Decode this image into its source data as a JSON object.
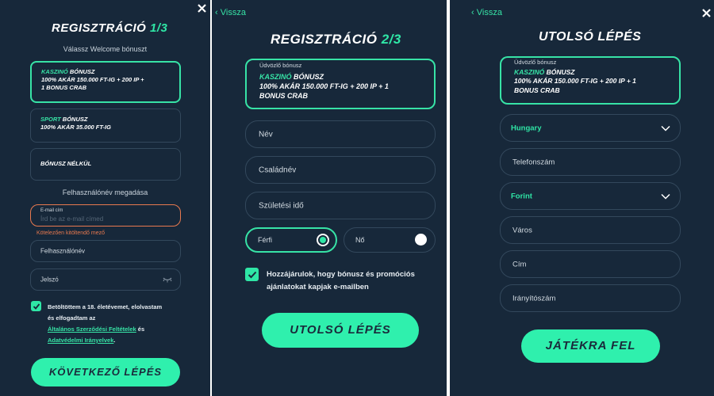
{
  "panel1": {
    "title_main": "REGISZTRÁCIÓ",
    "title_step": "1/3",
    "subtitle": "Válassz Welcome bónuszt",
    "bonus_options": [
      {
        "accent": "KASZINÓ",
        "rest": " BÓNUSZ",
        "line2": "100% AKÁR 150.000 FT-IG + 200 IP +",
        "line3": "1 BONUS CRAB",
        "selected": true
      },
      {
        "accent": "SPORT",
        "rest": " BÓNUSZ",
        "line2": "100% AKÁR 35.000 FT-IG",
        "line3": "",
        "selected": false
      },
      {
        "accent": "",
        "rest": "BÓNUSZ NÉLKÜL",
        "line2": "",
        "line3": "",
        "selected": false
      }
    ],
    "username_section": "Felhasználónév megadása",
    "email_label": "E-mail cím",
    "email_placeholder": "Írd be az e-mail címed",
    "email_error": "Kötelezően kitöltendő mező",
    "username_placeholder": "Felhasználónév",
    "password_placeholder": "Jelszó",
    "terms_line1": "Betöltöttem a 18. életévemet, elolvastam",
    "terms_line2": "és elfogadtam az",
    "terms_link1": "Általános Szerződési Feltételek",
    "terms_and": " és",
    "terms_link2": "Adatvédelmi Irányelvek",
    "terms_end": ".",
    "next_button": "KÖVETKEZŐ LÉPÉS"
  },
  "panel2": {
    "back_label": "Vissza",
    "title_main": "REGISZTRÁCIÓ",
    "title_step": "2/3",
    "bonus_caption": "Üdvözlő bónusz",
    "bonus_accent": "KASZINÓ",
    "bonus_rest": " BÓNUSZ",
    "bonus_line2": "100% AKÁR 150.000 FT-IG + 200 IP + 1",
    "bonus_line3": "BONUS CRAB",
    "first_name_placeholder": "Név",
    "last_name_placeholder": "Családnév",
    "birth_placeholder": "Születési idő",
    "gender_male": "Férfi",
    "gender_female": "Nő",
    "gender_selected": "Férfi",
    "consent_line1": "Hozzájárulok, hogy bónusz és promóciós",
    "consent_line2": "ajánlatokat kapjak e-mailben",
    "last_step_button": "UTOLSÓ LÉPÉS"
  },
  "panel3": {
    "back_label": "Vissza",
    "title": "UTOLSÓ LÉPÉS",
    "bonus_caption": "Üdvözlő bónusz",
    "bonus_accent": "KASZINÓ",
    "bonus_rest": " BÓNUSZ",
    "bonus_line2": "100% AKÁR 150.000 FT-IG + 200 IP + 1",
    "bonus_line3": "BONUS CRAB",
    "country_value": "Hungary",
    "phone_placeholder": "Telefonszám",
    "currency_value": "Forint",
    "city_placeholder": "Város",
    "address_placeholder": "Cím",
    "zip_placeholder": "Irányítószám",
    "play_button": "JÁTÉKRA FEL"
  },
  "colors": {
    "background": "#17283a",
    "accent": "#2fe6a6",
    "field_border": "#33485c",
    "error": "#e8794f"
  }
}
